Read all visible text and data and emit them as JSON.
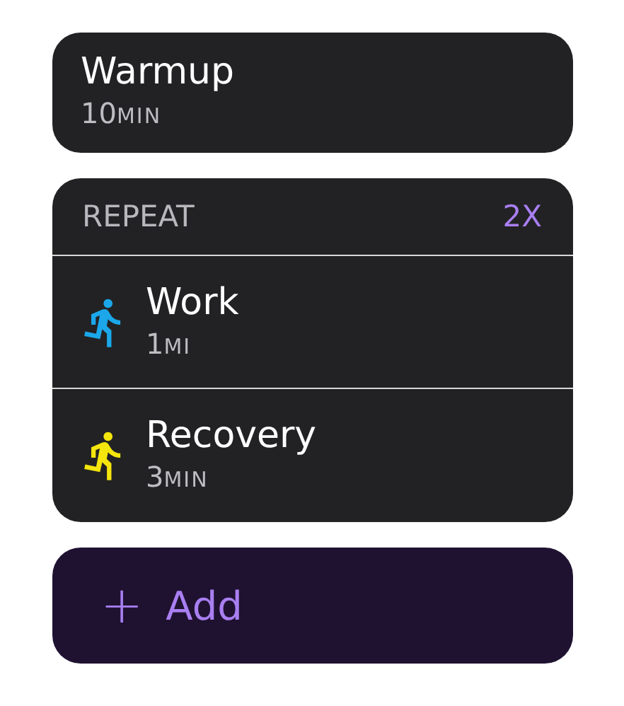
{
  "warmup": {
    "title": "Warmup",
    "value": "10",
    "unit": "MIN"
  },
  "repeat": {
    "label": "REPEAT",
    "count": "2X",
    "steps": [
      {
        "title": "Work",
        "value": "1",
        "unit": "MI",
        "color": "#1ba7ea"
      },
      {
        "title": "Recovery",
        "value": "3",
        "unit": "MIN",
        "color": "#f4e50d"
      }
    ]
  },
  "add": {
    "icon": "+",
    "label": "Add"
  }
}
